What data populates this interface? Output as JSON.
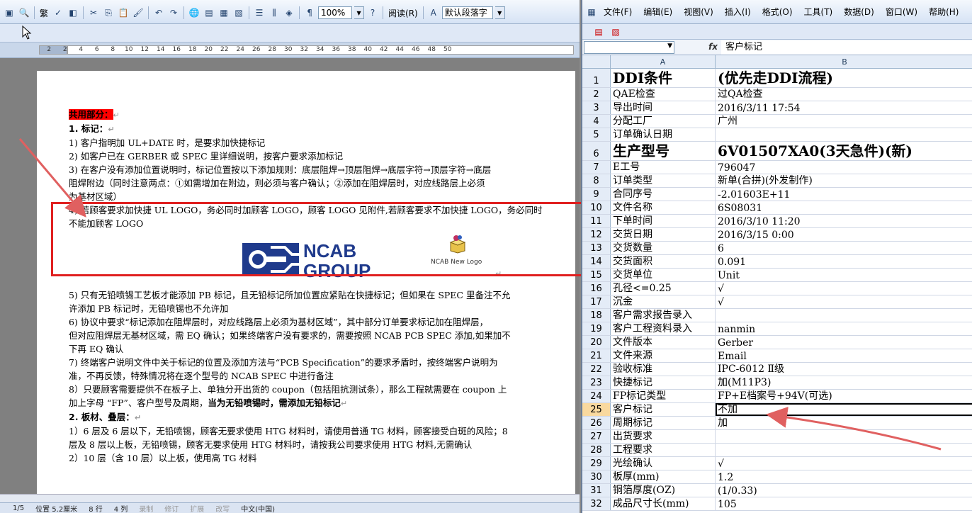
{
  "word": {
    "toolbar": {
      "traditional_label": "繁",
      "zoom": "100%",
      "reading_label": "阅读(R)",
      "style_value": "默认段落字"
    },
    "ruler": [
      "2",
      "2",
      "4",
      "6",
      "8",
      "10",
      "12",
      "14",
      "16",
      "18",
      "20",
      "22",
      "24",
      "26",
      "28",
      "30",
      "32",
      "34",
      "36",
      "38",
      "40",
      "42",
      "44",
      "46",
      "48",
      "50"
    ],
    "doc": {
      "heading": "共用部分：",
      "section1": "1.   标记：",
      "items1": [
        "1)  客户指明加 UL+DATE 时，是要求加快捷标记",
        "2)  如客户已在 GERBER 或 SPEC 里详细说明，按客户要求添加标记",
        "3)  在客户没有添加位置说明时，标记位置按以下添加规则：底层阻焊→顶层阻焊→底层字符→顶层字符→底层",
        "     阻焊附边（同时注意两点：①如需增加在附边，则必须与客户确认；②添加在阻焊层时，对应线路层上必须",
        "     为基材区域）",
        "4)  若顾客要求加快捷 UL LOGO，务必同时加顾客 LOGO，顾客 LOGO 见附件,若顾客要求不加快捷 LOGO，务必同时",
        "     不能加顾客 LOGO"
      ],
      "logo_top": "NCAB",
      "logo_bottom": "GROUP",
      "package_label": "NCAB New Logo",
      "items2": [
        "5)  只有无铅喷锡工艺板才能添加 PB 标记，且无铅标记所加位置应紧贴在快捷标记；但如果在 SPEC 里备注不允",
        "     许添加 PB 标记时，无铅喷锡也不允许加",
        "6)  协议中要求“标记添加在阻焊层时，对应线路层上必须为基材区域”，其中部分订单要求标记加在阻焊层，",
        "     但对应阻焊层无基材区域，需 EQ 确认；如果终端客户没有要求的，需要按照 NCAB PCB SPEC 添加,如果加不",
        "     下再 EQ 确认",
        "7)  终端客户说明文件中关于标记的位置及添加方法与“PCB Specification”的要求矛盾时，按终端客户说明为",
        "     准，不再反馈，特殊情况将在逐个型号的 NCAB SPEC 中进行备注"
      ],
      "item8_a": "8）只要顾客需要提供不在板子上、单独分开出货的 coupon（包括阻抗测试条），那么工程就需要在 coupon 上",
      "item8_b_plain": "     加上字母 “FP”、客户型号及周期，",
      "item8_b_bold": "当为无铅喷锡时，需添加无铅标记",
      "section2": "2.   板材、叠层：",
      "items3": [
        "1）6 层及 6 层以下，无铅喷锡，顾客无要求使用 HTG 材料时，请使用普通 TG 材料，顾客接受白斑的风险；8",
        "     层及 8 层以上板，无铅喷锡，顾客无要求使用 HTG 材料时，请按我公司要求使用 HTG 材料,无需确认",
        "2）10 层（含 10 层）以上板，使用高 TG 材料"
      ]
    },
    "status": {
      "page": "1/5",
      "position": "位置 5.2厘米",
      "line": "8 行",
      "column": "4 列",
      "rec": "录制",
      "trk": "修订",
      "ext": "扩展",
      "ovr": "改写",
      "lang": "中文(中国)"
    }
  },
  "excel": {
    "menu": [
      "文件(F)",
      "编辑(E)",
      "视图(V)",
      "插入(I)",
      "格式(O)",
      "工具(T)",
      "数据(D)",
      "窗口(W)",
      "帮助(H)"
    ],
    "formula_bar": {
      "fx": "fx",
      "value": "客户标记"
    },
    "columns": [
      "A",
      "B"
    ],
    "rows": [
      {
        "n": "1",
        "a": "DDI条件",
        "b": "(优先走DDI流程)",
        "big": true
      },
      {
        "n": "2",
        "a": "QAE检查",
        "b": "过QA检查"
      },
      {
        "n": "3",
        "a": "导出时间",
        "b": "2016/3/11 17:54"
      },
      {
        "n": "4",
        "a": "分配工厂",
        "b": "广州"
      },
      {
        "n": "5",
        "a": "订单确认日期",
        "b": ""
      },
      {
        "n": "6",
        "a": "生产型号",
        "b": "6V01507XA0(3天急件)(新)",
        "big": true
      },
      {
        "n": "7",
        "a": "E工号",
        "b": "796047"
      },
      {
        "n": "8",
        "a": "订单类型",
        "b": "新单(合拼)(外发制作)"
      },
      {
        "n": "9",
        "a": "合同序号",
        "b": "-2.01603E+11"
      },
      {
        "n": "10",
        "a": "文件名称",
        "b": "6S08031"
      },
      {
        "n": "11",
        "a": "下单时间",
        "b": "2016/3/10 11:20"
      },
      {
        "n": "12",
        "a": "交货日期",
        "b": "2016/3/15 0:00"
      },
      {
        "n": "13",
        "a": "交货数量",
        "b": "6"
      },
      {
        "n": "14",
        "a": "交货面积",
        "b": "0.091"
      },
      {
        "n": "15",
        "a": "交货单位",
        "b": "Unit"
      },
      {
        "n": "16",
        "a": "孔径<=0.25",
        "b": "√"
      },
      {
        "n": "17",
        "a": "沉金",
        "b": "√"
      },
      {
        "n": "18",
        "a": "客户需求报告录入",
        "b": ""
      },
      {
        "n": "19",
        "a": "客户工程资料录入",
        "b": "nanmin"
      },
      {
        "n": "20",
        "a": "文件版本",
        "b": "Gerber"
      },
      {
        "n": "21",
        "a": "文件来源",
        "b": "Email"
      },
      {
        "n": "22",
        "a": "验收标准",
        "b": "IPC-6012 Ⅱ级"
      },
      {
        "n": "23",
        "a": "快捷标记",
        "b": "加(M11P3)"
      },
      {
        "n": "24",
        "a": "FP标记类型",
        "b": "FP+E档案号+94V(可选)"
      },
      {
        "n": "25",
        "a": "客户标记",
        "b": "不加",
        "sel": true
      },
      {
        "n": "26",
        "a": "周期标记",
        "b": "加"
      },
      {
        "n": "27",
        "a": "出货要求",
        "b": ""
      },
      {
        "n": "28",
        "a": "工程要求",
        "b": ""
      },
      {
        "n": "29",
        "a": "光绘确认",
        "b": "√"
      },
      {
        "n": "30",
        "a": "板厚(mm)",
        "b": "1.2"
      },
      {
        "n": "31",
        "a": "铜箔厚度(OZ)",
        "b": "(1/0.33)"
      },
      {
        "n": "32",
        "a": "成品尺寸长(mm)",
        "b": "105"
      }
    ]
  },
  "colors": {
    "annotation_red": "#e02020",
    "arrow_pink": "#e06060",
    "highlight_red": "#ff0000"
  }
}
